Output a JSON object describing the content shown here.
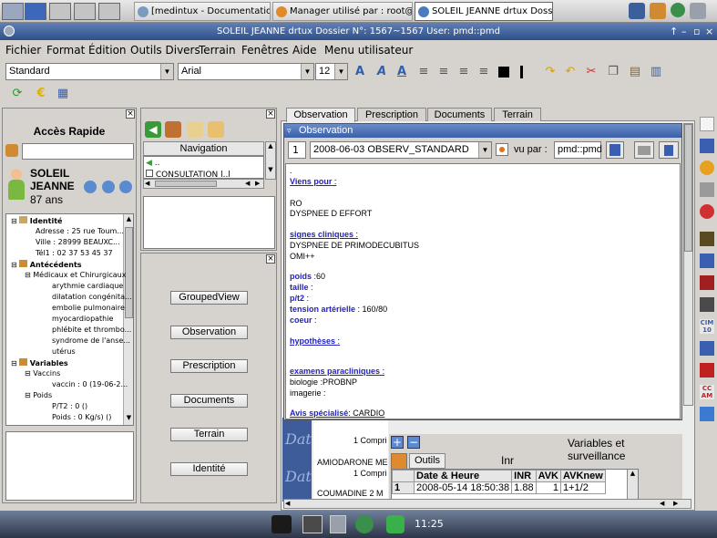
{
  "taskbar": {
    "tasks": [
      {
        "label": "[medintux - Documentation ..."
      },
      {
        "label": "Manager utilisé par : root@l..."
      },
      {
        "label": "SOLEIL JEANNE  drtux Dossi..."
      }
    ]
  },
  "window": {
    "title": "SOLEIL JEANNE  drtux Dossier N°: 1567~1567  User: pmd::pmd"
  },
  "menu": [
    "Fichier",
    "Format",
    "Édition",
    "Outils Divers",
    "Terrain",
    "Fenêtres",
    "Aide",
    "Menu utilisateur"
  ],
  "toolbar": {
    "style_value": "Standard",
    "font_value": "Arial",
    "size_value": "12"
  },
  "quick_access": {
    "title": "Accès Rapide",
    "patient_first": "SOLEIL",
    "patient_last": "JEANNE",
    "age": "87 ans",
    "tree": [
      "Identité",
      "Adresse : 25 rue Toum...",
      "Ville : 28999 BEAUXC...",
      "Tél1 : 02 37 53 45 37",
      "Antécédents",
      "Médicaux et Chirurgicaux",
      "arythmie cardiaque",
      "dilatation congénita...",
      "embolie pulmonaire",
      "myocardiopathie",
      "phlébite et thrombo...",
      "syndrome de l'anse...",
      "utérus",
      "Variables",
      "Vaccins",
      "vaccin : 0  (19-06-2...",
      "Poids",
      "P/T2 : 0  ()",
      "Poids : 0 Kg/s) ()"
    ]
  },
  "navigation": {
    "title": "Navigation",
    "rows": [
      "..",
      "CONSULTATION l..l"
    ]
  },
  "views": [
    "GroupedView",
    "Observation",
    "Prescription",
    "Documents",
    "Terrain",
    "Identité"
  ],
  "tabs": [
    "Observation",
    "Prescription",
    "Documents",
    "Terrain"
  ],
  "observation": {
    "panel_title": "Observation",
    "index": "1",
    "doc_select": "2008-06-03 OBSERV_STANDARD",
    "vu_par_label": "vu par :",
    "vu_par_value": "pmd::pmd",
    "dot": ".",
    "viens_pour": "Viens pour",
    "reasons": [
      "RO",
      "DYSPNEE D EFFORT"
    ],
    "signes_label": "signes cliniques",
    "signes": [
      "DYSPNEE DE PRIMODECUBITUS",
      "OMI++"
    ],
    "poids_label": "poids",
    "poids_val": ":60",
    "taille_label": "taille",
    "pt2_label": "p/t2",
    "ta_label": "tension artérielle",
    "ta_val": ": 160/80",
    "coeur_label": "coeur",
    "hyp_label": "hypothèses",
    "exam_label": "examens paracliniques",
    "exams": [
      "biologie :PROBNP",
      "imagerie :"
    ],
    "avis_label": "Avis spécialisé",
    "avis_val": ": CARDIO"
  },
  "background_doc": {
    "lines": [
      "1 Compri",
      "AMIODARONE ME",
      "1 Compri",
      "COUMADINE 2 M"
    ],
    "dat": "Dat"
  },
  "variables": {
    "title": "Variables et surveillance",
    "tab": "Outils",
    "tab_title": "Inr",
    "columns": [
      "Date & Heure",
      "INR",
      "AVK",
      "AVKnew"
    ],
    "rows": [
      {
        "idx": "1",
        "date": "2008-05-14  18:50:38",
        "inr": "1.88",
        "avk": "1",
        "avknew": "1+1/2"
      }
    ]
  },
  "clock": "11:25"
}
